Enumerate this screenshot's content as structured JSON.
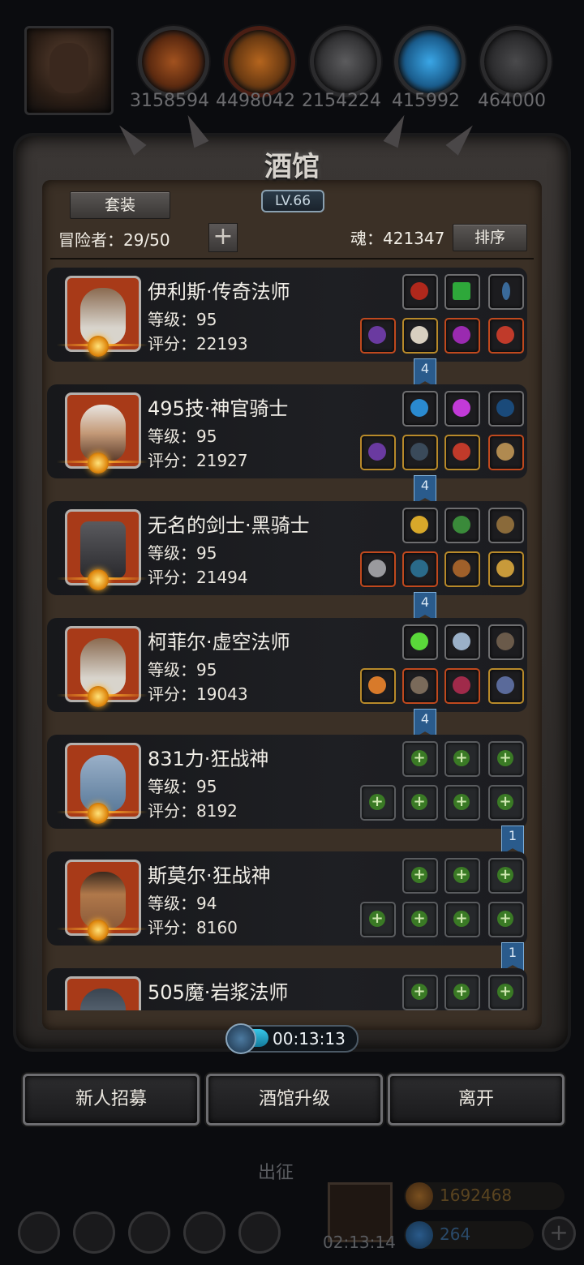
{
  "resources": [
    {
      "name": "meat",
      "value": "3158594"
    },
    {
      "name": "wood",
      "value": "4498042"
    },
    {
      "name": "iron",
      "value": "2154224"
    },
    {
      "name": "crystal",
      "value": "415992"
    },
    {
      "name": "stone",
      "value": "464000"
    }
  ],
  "tavern": {
    "title": "酒馆",
    "level": "LV.66",
    "set_button": "套装",
    "adventurers": "冒险者：29/50",
    "soul": "魂：421347",
    "sort_button": "排序"
  },
  "heroes": [
    {
      "name": "伊利斯·传奇法师",
      "level": "等级：95",
      "score": "评分：22193",
      "ribbon": "4"
    },
    {
      "name": "495技·神官骑士",
      "level": "等级：95",
      "score": "评分：21927",
      "ribbon": "4"
    },
    {
      "name": "无名的剑士·黑骑士",
      "level": "等级：95",
      "score": "评分：21494",
      "ribbon": "4"
    },
    {
      "name": "柯菲尔·虚空法师",
      "level": "等级：95",
      "score": "评分：19043",
      "ribbon": "4"
    },
    {
      "name": "831力·狂战神",
      "level": "等级：95",
      "score": "评分：8192",
      "ribbon": "1"
    },
    {
      "name": "斯莫尔·狂战神",
      "level": "等级：94",
      "score": "评分：8160",
      "ribbon": "1"
    },
    {
      "name": "505魔·岩浆法师",
      "level": "",
      "score": "",
      "ribbon": ""
    }
  ],
  "timer": {
    "text": "00:13:13",
    "progress": 0.3
  },
  "buttons": {
    "recruit": "新人招募",
    "upgrade": "酒馆升级",
    "leave": "离开"
  },
  "background": {
    "expedition": "出征",
    "gift_timer": "02:13:14",
    "gold": "1692468",
    "gems": "264"
  },
  "colors": {
    "accent_gold": "#ffb12a",
    "ribbon_blue": "#2a5b8c",
    "panel_brown": "#3b3026"
  }
}
